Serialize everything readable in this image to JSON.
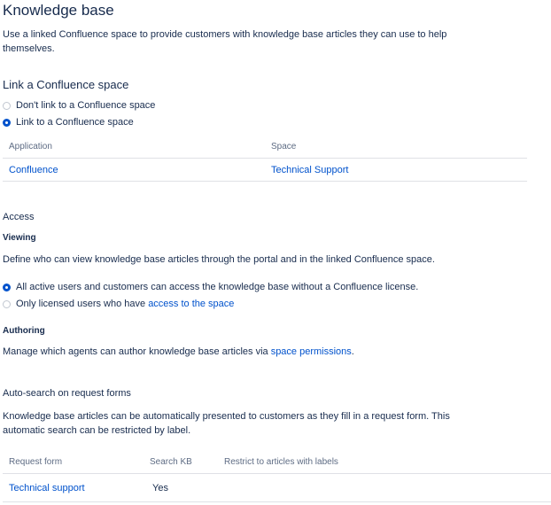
{
  "page": {
    "title": "Knowledge base",
    "description": "Use a linked Confluence space to provide customers with knowledge base articles they can use to help themselves."
  },
  "link_section": {
    "heading": "Link a Confluence space",
    "options": [
      {
        "label": "Don't link to a Confluence space",
        "checked": false
      },
      {
        "label": "Link to a Confluence space",
        "checked": true
      }
    ],
    "table": {
      "headers": [
        "Application",
        "Space"
      ],
      "rows": [
        {
          "application": "Confluence",
          "space": "Technical Support"
        }
      ]
    }
  },
  "access": {
    "heading": "Access",
    "viewing": {
      "subheading": "Viewing",
      "description": "Define who can view knowledge base articles through the portal and in the linked Confluence space.",
      "options": [
        {
          "label": "All active users and customers can access the knowledge base without a Confluence license.",
          "checked": true
        },
        {
          "label": "Only licensed users who have ",
          "link": "access to the space",
          "checked": false
        }
      ]
    },
    "authoring": {
      "subheading": "Authoring",
      "description_prefix": "Manage which agents can author knowledge base articles via ",
      "link": "space permissions",
      "description_suffix": "."
    }
  },
  "autosearch": {
    "heading": "Auto-search on request forms",
    "description": "Knowledge base articles can be automatically presented to customers as they fill in a request form. This automatic search can be restricted by label.",
    "table": {
      "headers": [
        "Request form",
        "Search KB",
        "Restrict to articles with labels"
      ],
      "rows": [
        {
          "form": "Technical support",
          "search_kb": "Yes",
          "labels": ""
        }
      ]
    }
  },
  "colors": {
    "link": "#0052cc",
    "text": "#172b4d",
    "muted": "#5e6c84",
    "radio_checked": "#0052cc",
    "divider": "#dfe1e6"
  }
}
